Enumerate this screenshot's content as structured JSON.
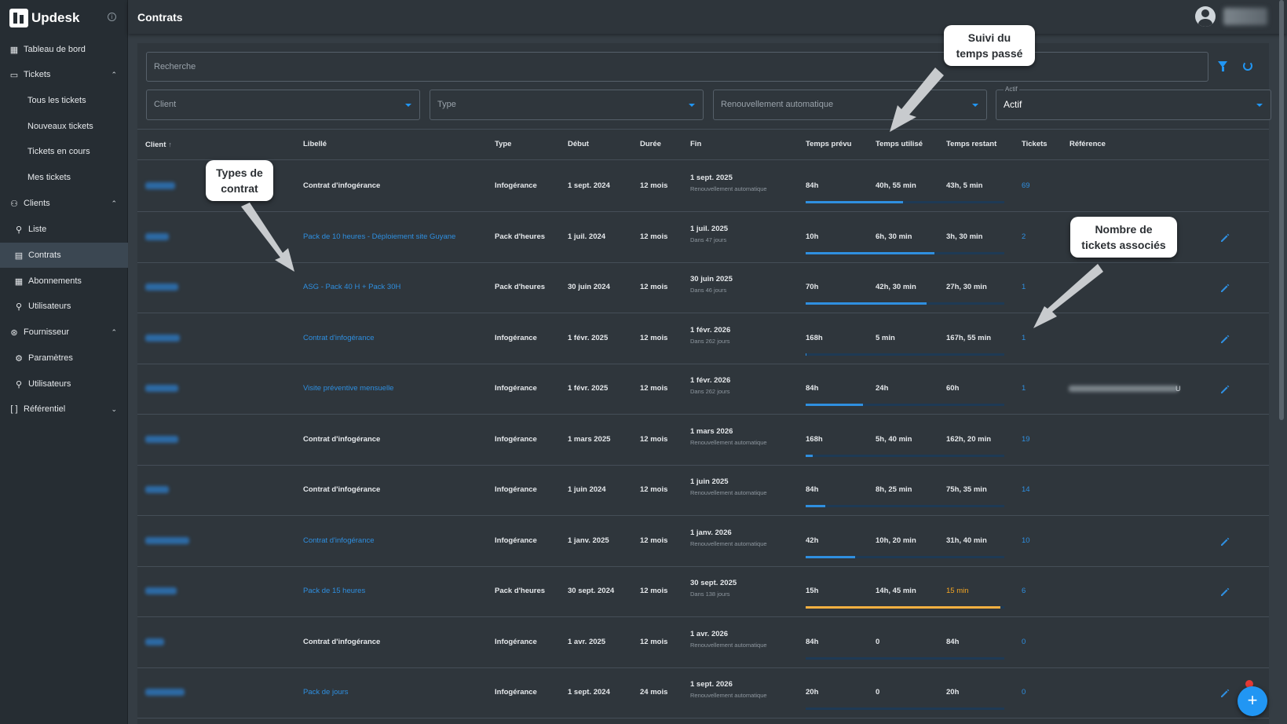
{
  "app": {
    "name": "Updesk",
    "page_title": "Contrats"
  },
  "sidebar": {
    "items": [
      {
        "label": "Tableau de bord",
        "icon": "dashboard-icon",
        "level": 0
      },
      {
        "label": "Tickets",
        "icon": "ticket-icon",
        "level": 0,
        "expanded": true
      },
      {
        "label": "Tous les tickets",
        "level": 1
      },
      {
        "label": "Nouveaux tickets",
        "level": 1
      },
      {
        "label": "Tickets en cours",
        "level": 1
      },
      {
        "label": "Mes tickets",
        "level": 1
      },
      {
        "label": "Clients",
        "icon": "clients-icon",
        "level": 0,
        "expanded": true
      },
      {
        "label": "Liste",
        "icon": "person-icon",
        "level": 1
      },
      {
        "label": "Contrats",
        "icon": "contract-icon",
        "level": 1,
        "active": true
      },
      {
        "label": "Abonnements",
        "icon": "calendar-icon",
        "level": 1
      },
      {
        "label": "Utilisateurs",
        "icon": "person-icon",
        "level": 1
      },
      {
        "label": "Fournisseur",
        "icon": "supplier-icon",
        "level": 0,
        "expanded": true
      },
      {
        "label": "Paramètres",
        "icon": "gear-icon",
        "level": 1
      },
      {
        "label": "Utilisateurs",
        "icon": "person-icon",
        "level": 1
      },
      {
        "label": "Référentiel",
        "icon": "brackets-icon",
        "level": 0,
        "expanded": false
      }
    ]
  },
  "filters": {
    "search_placeholder": "Recherche",
    "client_placeholder": "Client",
    "type_placeholder": "Type",
    "renewal_placeholder": "Renouvellement automatique",
    "active_label": "Actif",
    "active_value": "Actif"
  },
  "table": {
    "headers": {
      "client": "Client",
      "libelle": "Libellé",
      "type": "Type",
      "debut": "Début",
      "duree": "Durée",
      "fin": "Fin",
      "temps_prevu": "Temps prévu",
      "temps_utilise": "Temps utilisé",
      "temps_restant": "Temps restant",
      "tickets": "Tickets",
      "reference": "Référence"
    },
    "rows": [
      {
        "libelle": "Contrat d'infogérance",
        "libelle_link": false,
        "type": "Infogérance",
        "debut": "1 sept. 2024",
        "duree": "12 mois",
        "fin": "1 sept. 2025",
        "fin_sub": "Renouvellement automatique",
        "prevu": "84h",
        "utilise": "40h, 55 min",
        "restant": "43h, 5 min",
        "restant_warn": false,
        "tickets": "69",
        "progress": 0.49,
        "progress_warn": false,
        "editable": false,
        "has_reference": false
      },
      {
        "libelle": "Pack de 10 heures - Déploiement site Guyane",
        "libelle_link": true,
        "type": "Pack d'heures",
        "debut": "1 juil. 2024",
        "duree": "12 mois",
        "fin": "1 juil. 2025",
        "fin_sub": "Dans 47 jours",
        "prevu": "10h",
        "utilise": "6h, 30 min",
        "restant": "3h, 30 min",
        "restant_warn": false,
        "tickets": "2",
        "progress": 0.65,
        "progress_warn": false,
        "editable": true,
        "has_reference": false
      },
      {
        "libelle": "ASG - Pack 40 H + Pack 30H",
        "libelle_link": true,
        "type": "Pack d'heures",
        "debut": "30 juin 2024",
        "duree": "12 mois",
        "fin": "30 juin 2025",
        "fin_sub": "Dans 46 jours",
        "prevu": "70h",
        "utilise": "42h, 30 min",
        "restant": "27h, 30 min",
        "restant_warn": false,
        "tickets": "1",
        "progress": 0.61,
        "progress_warn": false,
        "editable": true,
        "has_reference": false
      },
      {
        "libelle": "Contrat d'infogérance",
        "libelle_link": true,
        "type": "Infogérance",
        "debut": "1 févr. 2025",
        "duree": "12 mois",
        "fin": "1 févr. 2026",
        "fin_sub": "Dans 262 jours",
        "prevu": "168h",
        "utilise": "5 min",
        "restant": "167h, 55 min",
        "restant_warn": false,
        "tickets": "1",
        "progress": 0.005,
        "progress_warn": false,
        "editable": true,
        "has_reference": false
      },
      {
        "libelle": "Visite préventive mensuelle",
        "libelle_link": true,
        "type": "Infogérance",
        "debut": "1 févr. 2025",
        "duree": "12 mois",
        "fin": "1 févr. 2026",
        "fin_sub": "Dans 262 jours",
        "prevu": "84h",
        "utilise": "24h",
        "restant": "60h",
        "restant_warn": false,
        "tickets": "1",
        "progress": 0.29,
        "progress_warn": false,
        "editable": true,
        "has_reference": true,
        "reference_tail": "U"
      },
      {
        "libelle": "Contrat d'infogérance",
        "libelle_link": false,
        "type": "Infogérance",
        "debut": "1 mars 2025",
        "duree": "12 mois",
        "fin": "1 mars 2026",
        "fin_sub": "Renouvellement automatique",
        "prevu": "168h",
        "utilise": "5h, 40 min",
        "restant": "162h, 20 min",
        "restant_warn": false,
        "tickets": "19",
        "progress": 0.034,
        "progress_warn": false,
        "editable": false,
        "has_reference": false
      },
      {
        "libelle": "Contrat d'infogérance",
        "libelle_link": false,
        "type": "Infogérance",
        "debut": "1 juin 2024",
        "duree": "12 mois",
        "fin": "1 juin 2025",
        "fin_sub": "Renouvellement automatique",
        "prevu": "84h",
        "utilise": "8h, 25 min",
        "restant": "75h, 35 min",
        "restant_warn": false,
        "tickets": "14",
        "progress": 0.1,
        "progress_warn": false,
        "editable": false,
        "has_reference": false
      },
      {
        "libelle": "Contrat d'infogérance",
        "libelle_link": true,
        "type": "Infogérance",
        "debut": "1 janv. 2025",
        "duree": "12 mois",
        "fin": "1 janv. 2026",
        "fin_sub": "Renouvellement automatique",
        "prevu": "42h",
        "utilise": "10h, 20 min",
        "restant": "31h, 40 min",
        "restant_warn": false,
        "tickets": "10",
        "progress": 0.25,
        "progress_warn": false,
        "editable": true,
        "has_reference": false
      },
      {
        "libelle": "Pack de 15 heures",
        "libelle_link": true,
        "type": "Pack d'heures",
        "debut": "30 sept. 2024",
        "duree": "12 mois",
        "fin": "30 sept. 2025",
        "fin_sub": "Dans 138 jours",
        "prevu": "15h",
        "utilise": "14h, 45 min",
        "restant": "15 min",
        "restant_warn": true,
        "tickets": "6",
        "progress": 0.98,
        "progress_warn": true,
        "editable": true,
        "has_reference": false
      },
      {
        "libelle": "Contrat d'infogérance",
        "libelle_link": false,
        "type": "Infogérance",
        "debut": "1 avr. 2025",
        "duree": "12 mois",
        "fin": "1 avr. 2026",
        "fin_sub": "Renouvellement automatique",
        "prevu": "84h",
        "utilise": "0",
        "restant": "84h",
        "restant_warn": false,
        "tickets": "0",
        "progress": 0,
        "progress_warn": false,
        "editable": false,
        "has_reference": false
      },
      {
        "libelle": "Pack de jours",
        "libelle_link": true,
        "type": "Infogérance",
        "debut": "1 sept. 2024",
        "duree": "24 mois",
        "fin": "1 sept. 2026",
        "fin_sub": "Renouvellement automatique",
        "prevu": "20h",
        "utilise": "0",
        "restant": "20h",
        "restant_warn": false,
        "tickets": "0",
        "progress": 0,
        "progress_warn": false,
        "editable": true,
        "has_reference": false
      }
    ]
  },
  "callouts": {
    "time": "Suivi du temps passé",
    "types": "Types de contrat",
    "tickets": "Nombre de tickets associés"
  },
  "colors": {
    "accent": "#2196f3",
    "link": "#2f8fe0",
    "warning": "#f5a623"
  }
}
